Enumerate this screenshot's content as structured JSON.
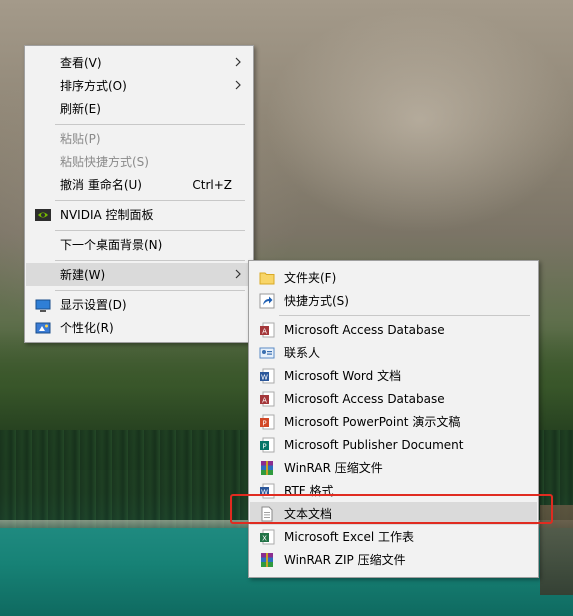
{
  "context_menu": {
    "items": [
      {
        "label": "查看(V)",
        "submenu": true
      },
      {
        "label": "排序方式(O)",
        "submenu": true
      },
      {
        "label": "刷新(E)"
      },
      {
        "label": "粘贴(P)",
        "disabled": true
      },
      {
        "label": "粘贴快捷方式(S)",
        "disabled": true
      },
      {
        "label": "撤消 重命名(U)",
        "shortcut": "Ctrl+Z"
      },
      {
        "label": "NVIDIA 控制面板",
        "icon": "nvidia-icon"
      },
      {
        "label": "下一个桌面背景(N)"
      },
      {
        "label": "新建(W)",
        "submenu": true,
        "highlighted": true
      },
      {
        "label": "显示设置(D)",
        "icon": "display-settings-icon"
      },
      {
        "label": "个性化(R)",
        "icon": "personalize-icon"
      }
    ]
  },
  "new_submenu": {
    "items": [
      {
        "label": "文件夹(F)",
        "icon": "folder-icon"
      },
      {
        "label": "快捷方式(S)",
        "icon": "shortcut-icon"
      },
      {
        "label": "Microsoft Access Database",
        "icon": "access-icon"
      },
      {
        "label": "联系人",
        "icon": "contact-icon"
      },
      {
        "label": "Microsoft Word 文档",
        "icon": "word-icon"
      },
      {
        "label": "Microsoft Access Database",
        "icon": "access-icon"
      },
      {
        "label": "Microsoft PowerPoint 演示文稿",
        "icon": "powerpoint-icon"
      },
      {
        "label": "Microsoft Publisher Document",
        "icon": "publisher-icon"
      },
      {
        "label": "WinRAR 压缩文件",
        "icon": "winrar-icon"
      },
      {
        "label": "RTF 格式",
        "icon": "rtf-icon"
      },
      {
        "label": "文本文档",
        "icon": "text-document-icon",
        "highlighted": true
      },
      {
        "label": "Microsoft Excel 工作表",
        "icon": "excel-icon"
      },
      {
        "label": "WinRAR ZIP 压缩文件",
        "icon": "winrar-zip-icon"
      }
    ]
  },
  "colors": {
    "menu_bg": "#f2f2f2",
    "highlight": "#dadada",
    "annotation_red": "#e02b20",
    "disabled_text": "#8a8a8a"
  }
}
